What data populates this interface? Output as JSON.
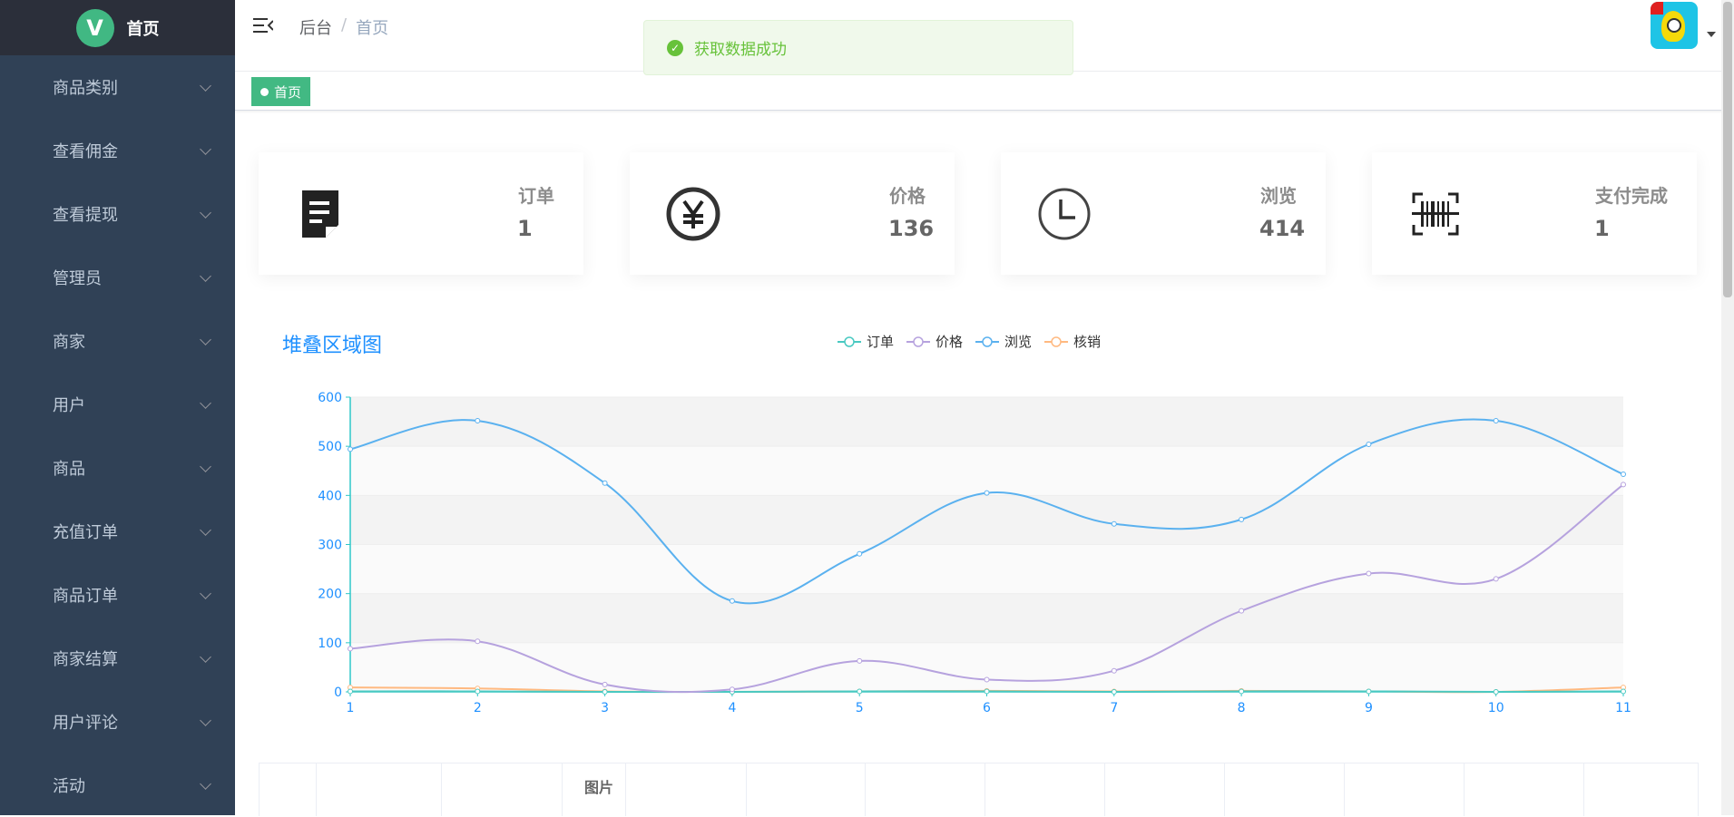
{
  "sidebar": {
    "logo_letter": "V",
    "logo_text": "首页",
    "items": [
      {
        "label": "商品类别"
      },
      {
        "label": "查看佣金"
      },
      {
        "label": "查看提现"
      },
      {
        "label": "管理员"
      },
      {
        "label": "商家"
      },
      {
        "label": "用户"
      },
      {
        "label": "商品"
      },
      {
        "label": "充值订单"
      },
      {
        "label": "商品订单"
      },
      {
        "label": "商家结算"
      },
      {
        "label": "用户评论"
      },
      {
        "label": "活动"
      }
    ]
  },
  "header": {
    "breadcrumb": {
      "root": "后台",
      "separator": "/",
      "current": "首页"
    }
  },
  "tags": {
    "active": "首页"
  },
  "toast": {
    "message": "获取数据成功",
    "icon": "check-circle-icon",
    "color": "#67c23a"
  },
  "stats": [
    {
      "title": "订单",
      "value": "1",
      "icon": "document-icon"
    },
    {
      "title": "价格",
      "value": "136",
      "icon": "yen-icon"
    },
    {
      "title": "浏览",
      "value": "414",
      "icon": "clock-icon"
    },
    {
      "title": "支付完成",
      "value": "1",
      "icon": "barcode-scan-icon"
    }
  ],
  "chart_data": {
    "type": "line",
    "title": "堆叠区域图",
    "x": [
      1,
      2,
      3,
      4,
      5,
      6,
      7,
      8,
      9,
      10,
      11
    ],
    "ylim": [
      0,
      600
    ],
    "yticks": [
      0,
      100,
      200,
      300,
      400,
      500,
      600
    ],
    "legend_position": "top-center",
    "smooth": true,
    "series": [
      {
        "name": "订单",
        "color": "#48c9c1",
        "values": [
          1,
          1,
          0,
          0,
          1,
          1,
          0,
          1,
          1,
          0,
          1
        ]
      },
      {
        "name": "价格",
        "color": "#b6a2de",
        "values": [
          88,
          103,
          15,
          5,
          63,
          25,
          43,
          165,
          241,
          230,
          422
        ]
      },
      {
        "name": "浏览",
        "color": "#5ab1ef",
        "values": [
          494,
          552,
          425,
          185,
          281,
          405,
          342,
          351,
          504,
          552,
          443
        ]
      },
      {
        "name": "核销",
        "color": "#ffb980",
        "values": [
          9,
          7,
          1,
          0,
          1,
          2,
          1,
          2,
          1,
          0,
          9
        ]
      }
    ]
  },
  "table": {
    "image_header": "图片"
  }
}
